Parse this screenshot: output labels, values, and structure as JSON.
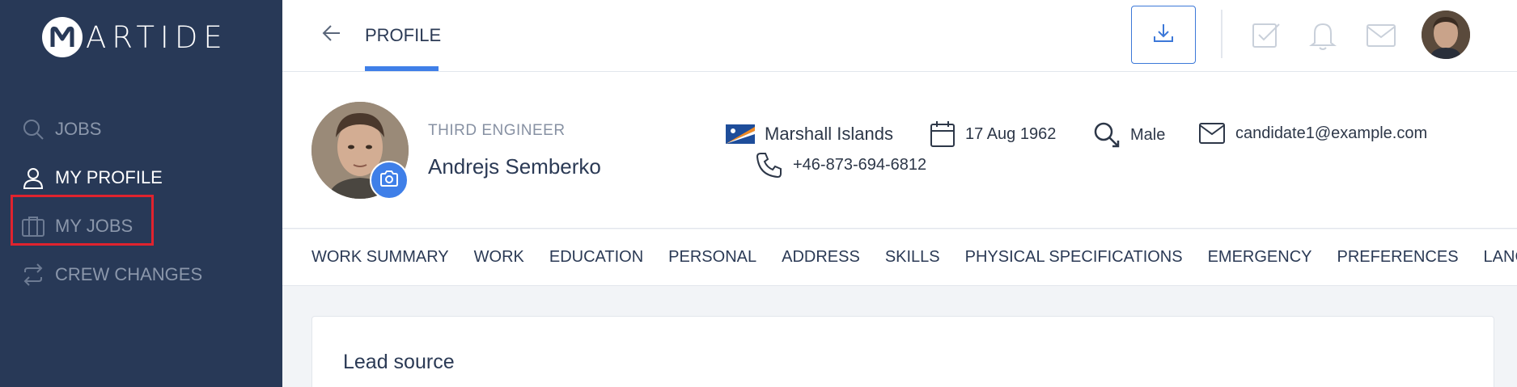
{
  "app": {
    "logo_text": "ARTIDE",
    "logo_letter": "M",
    "colors": {
      "sidebar": "#283957",
      "accent": "#3f7fe8",
      "highlight": "#e0232e"
    }
  },
  "sidebar": {
    "items": [
      {
        "label": "JOBS",
        "icon": "search-icon",
        "active": false
      },
      {
        "label": "MY PROFILE",
        "icon": "user-icon",
        "active": true
      },
      {
        "label": "MY JOBS",
        "icon": "briefcase-icon",
        "active": false
      },
      {
        "label": "CREW CHANGES",
        "icon": "swap-icon",
        "active": false
      }
    ]
  },
  "header": {
    "title": "PROFILE",
    "icons": [
      "back-arrow-icon",
      "download-icon",
      "checkbox-icon",
      "bell-icon",
      "mail-icon",
      "avatar"
    ]
  },
  "profile": {
    "job_title": "THIRD ENGINEER",
    "name": "Andrejs Semberko",
    "nationality": "Marshall Islands",
    "birth_date": "17 Aug 1962",
    "gender": "Male",
    "email": "candidate1@example.com",
    "phone": "+46-873-694-6812"
  },
  "tabs": [
    "WORK SUMMARY",
    "WORK",
    "EDUCATION",
    "PERSONAL",
    "ADDRESS",
    "SKILLS",
    "PHYSICAL SPECIFICATIONS",
    "EMERGENCY",
    "PREFERENCES",
    "LANGUAGES"
  ],
  "content": {
    "card_title": "Lead source"
  }
}
